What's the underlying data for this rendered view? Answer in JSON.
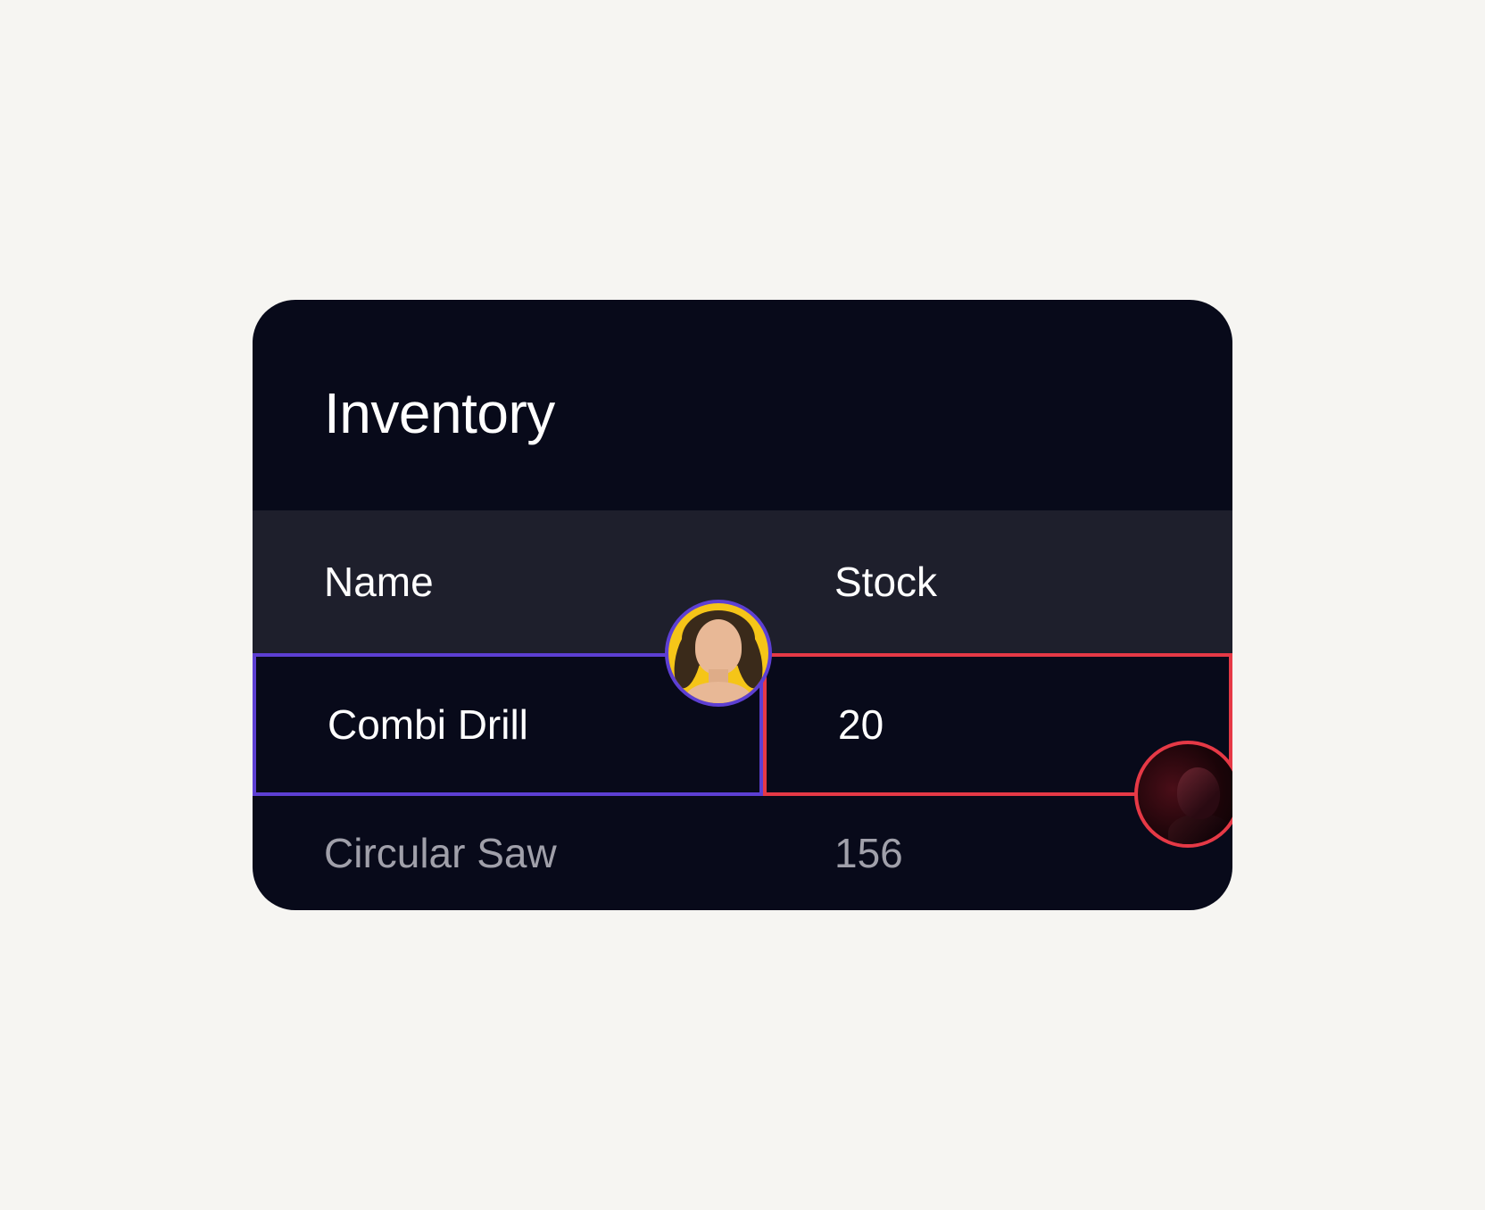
{
  "card": {
    "title": "Inventory"
  },
  "table": {
    "headers": {
      "name": "Name",
      "stock": "Stock"
    },
    "rows": [
      {
        "name": "Combi Drill",
        "stock": "20"
      },
      {
        "name": "Circular Saw",
        "stock": "156"
      }
    ]
  },
  "collaborators": {
    "user1": {
      "color": "#5d3fd3",
      "selecting": "name-cell-row-0"
    },
    "user2": {
      "color": "#e63946",
      "selecting": "stock-cell-row-0"
    }
  }
}
